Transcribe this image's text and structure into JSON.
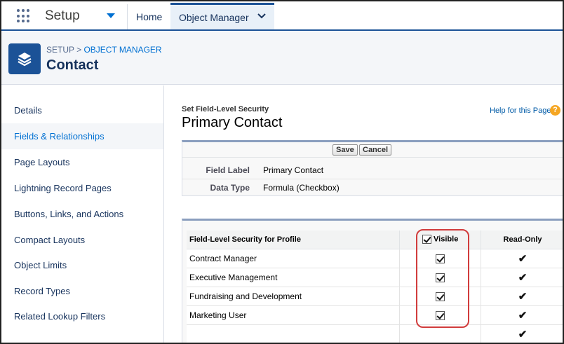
{
  "topnav": {
    "app_name": "Setup",
    "home": "Home",
    "object_manager": "Object Manager"
  },
  "header": {
    "crumb_prefix": "SETUP > ",
    "crumb_link": "OBJECT MANAGER",
    "title": "Contact"
  },
  "sidebar": {
    "items": [
      {
        "label": "Details"
      },
      {
        "label": "Fields & Relationships",
        "active": true
      },
      {
        "label": "Page Layouts"
      },
      {
        "label": "Lightning Record Pages"
      },
      {
        "label": "Buttons, Links, and Actions"
      },
      {
        "label": "Compact Layouts"
      },
      {
        "label": "Object Limits"
      },
      {
        "label": "Record Types"
      },
      {
        "label": "Related Lookup Filters"
      }
    ]
  },
  "main": {
    "subtitle": "Set Field-Level Security",
    "title": "Primary Contact",
    "help_link": "Help for this Page",
    "help_icon": "?",
    "save_label": "Save",
    "cancel_label": "Cancel",
    "field_label_label": "Field Label",
    "field_label_value": "Primary Contact",
    "data_type_label": "Data Type",
    "data_type_value": "Formula (Checkbox)"
  },
  "fls_table": {
    "headers": {
      "profile": "Field-Level Security for Profile",
      "visible": "Visible",
      "read_only": "Read-Only"
    },
    "rows": [
      {
        "profile": "Contract Manager",
        "visible": true,
        "read_only": true
      },
      {
        "profile": "Executive Management",
        "visible": true,
        "read_only": true
      },
      {
        "profile": "Fundraising and Development",
        "visible": true,
        "read_only": true
      },
      {
        "profile": "Marketing User",
        "visible": true,
        "read_only": true
      }
    ]
  },
  "colors": {
    "brand_blue": "#1b5297",
    "link_blue": "#0070d2",
    "highlight_red": "#d13c3c"
  },
  "icons": {
    "app_launcher": "waffle-icon",
    "object": "layers-icon",
    "help": "help-icon"
  }
}
